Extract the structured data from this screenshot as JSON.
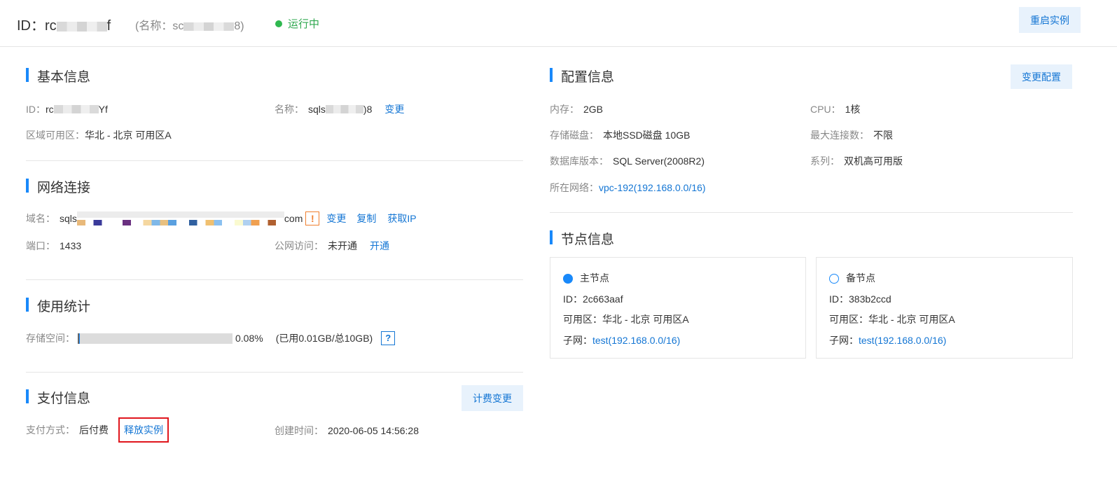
{
  "header": {
    "id_label": "ID：",
    "id_value_prefix": "rc",
    "id_value_suffix": "f",
    "name_prefix": "(名称：sc",
    "name_suffix": "8)",
    "status": "运行中",
    "restart_button": "重启实例"
  },
  "basic": {
    "title": "基本信息",
    "id_label": "ID：",
    "id_value_prefix": "rc",
    "id_value_suffix": "Yf",
    "name_label": "名称：",
    "name_value_prefix": "sqls",
    "name_value_suffix": ")8",
    "name_change": "变更",
    "zone_label": "区域可用区：",
    "zone_value": "华北 - 北京 可用区A"
  },
  "network": {
    "title": "网络连接",
    "domain_label": "域名：",
    "domain_prefix": "sqls",
    "domain_suffix": "com",
    "warn_icon": "!",
    "change": "变更",
    "copy": "复制",
    "get_ip": "获取IP",
    "port_label": "端口：",
    "port_value": "1433",
    "public_label": "公网访问：",
    "public_value": "未开通",
    "public_open": "开通"
  },
  "usage": {
    "title": "使用统计",
    "storage_label": "存储空间：",
    "percent_text": "0.08%",
    "percent": 0.08,
    "detail": "(已用0.01GB/总10GB)",
    "help": "?"
  },
  "payment": {
    "title": "支付信息",
    "billing_button": "计费变更",
    "method_label": "支付方式：",
    "method_value": "后付费",
    "release": "释放实例",
    "created_label": "创建时间：",
    "created_value": "2020-06-05 14:56:28"
  },
  "config": {
    "title": "配置信息",
    "change_button": "变更配置",
    "memory_label": "内存：",
    "memory_value": "2GB",
    "cpu_label": "CPU：",
    "cpu_value": "1核",
    "disk_label": "存储磁盘：",
    "disk_value": "本地SSD磁盘 10GB",
    "maxconn_label": "最大连接数：",
    "maxconn_value": "不限",
    "dbver_label": "数据库版本：",
    "dbver_value": "SQL Server(2008R2)",
    "series_label": "系列：",
    "series_value": "双机高可用版",
    "network_label": "所在网络：",
    "network_value": "vpc-192(192.168.0.0/16)"
  },
  "nodes": {
    "title": "节点信息",
    "primary": {
      "label": "主节点",
      "id": "ID：2c663aaf",
      "zone": "可用区：华北 - 北京 可用区A",
      "subnet_label": "子网：",
      "subnet_value": "test(192.168.0.0/16)"
    },
    "standby": {
      "label": "备节点",
      "id": "ID：383b2ccd",
      "zone": "可用区：华北 - 北京 可用区A",
      "subnet_label": "子网：",
      "subnet_value": "test(192.168.0.0/16)"
    }
  },
  "colors": {
    "accent": "#1989fa",
    "link": "#1476d4",
    "running": "#2fb84f",
    "highlight": "#e0161d"
  }
}
